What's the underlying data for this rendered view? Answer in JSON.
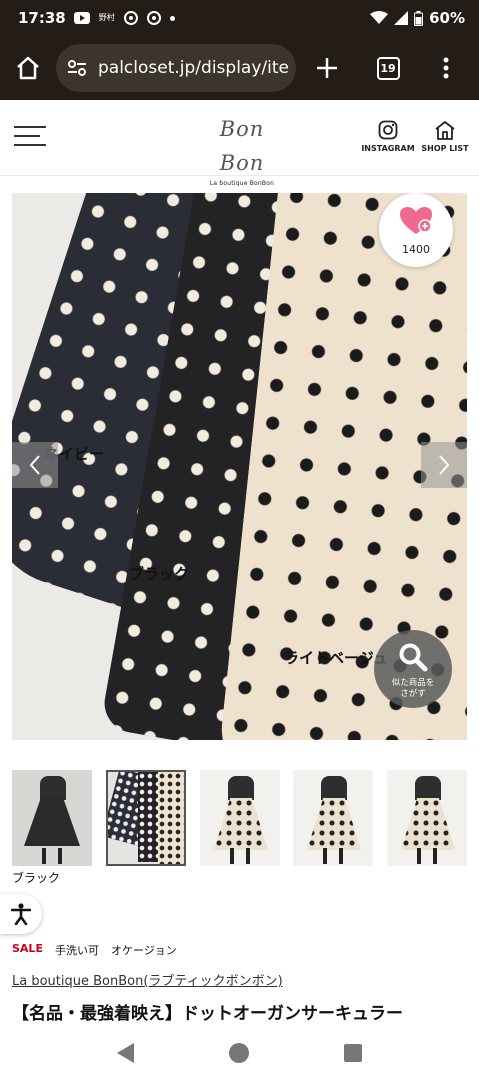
{
  "status_bar": {
    "time": "17:38",
    "notification_text": "野村",
    "battery_percent": "60%",
    "icons": [
      "youtube-icon",
      "chrome-icon",
      "chrome-icon",
      "dot-icon",
      "wifi-icon",
      "signal-icon",
      "battery-icon"
    ]
  },
  "browser": {
    "url": "palcloset.jp/display/ite",
    "tab_count": "19"
  },
  "site_header": {
    "logo_script": "Bon Bon",
    "logo_subtitle": "La boutique BonBon",
    "instagram_label": "INSTAGRAM",
    "shop_list_label": "SHOP LIST"
  },
  "product_image": {
    "labels": {
      "navy": "ネイビー",
      "black": "ブラック",
      "beige": "ライトベージュ"
    },
    "favorite_count": "1400",
    "similar_search_label": "似た商品を\nさがす"
  },
  "thumbnails": {
    "selected_index": 1,
    "caption": "ブラック"
  },
  "product_info": {
    "tags": [
      "SALE",
      "手洗い可",
      "オケージョン"
    ],
    "brand": "La boutique BonBon(ラブティックボンボン)",
    "title": "【名品・最強着映え】ドットオーガンサーキュラー"
  },
  "colors": {
    "browser_bg": "#231c17",
    "url_pill_bg": "#3d342b",
    "sale_red": "#d0021b",
    "heart_pink": "#f06a8f"
  }
}
